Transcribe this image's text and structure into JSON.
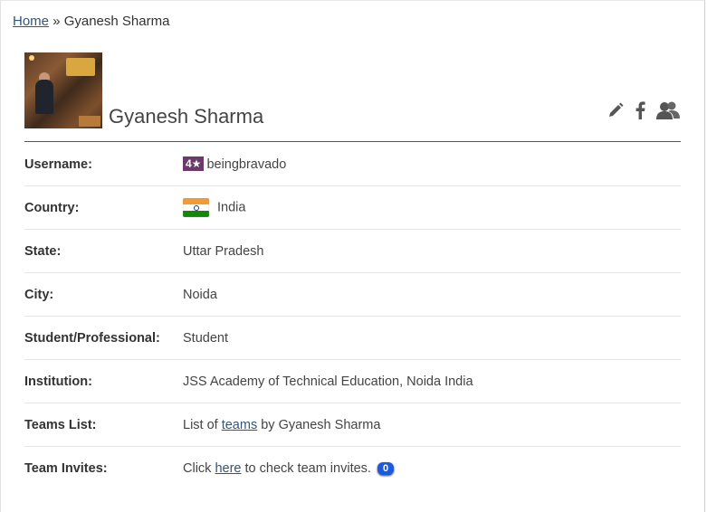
{
  "breadcrumb": {
    "home": "Home",
    "separator": " » ",
    "current": "Gyanesh Sharma"
  },
  "profile": {
    "name": "Gyanesh Sharma",
    "actions": [
      "pencil-icon",
      "facebook-icon",
      "users-icon"
    ]
  },
  "rows": {
    "username": {
      "label": "Username:",
      "stars": "4★",
      "value": "beingbravado"
    },
    "country": {
      "label": "Country:",
      "value": "India"
    },
    "state": {
      "label": "State:",
      "value": "Uttar Pradesh"
    },
    "city": {
      "label": "City:",
      "value": "Noida"
    },
    "student": {
      "label": "Student/Professional:",
      "value": "Student"
    },
    "institution": {
      "label": "Institution:",
      "value": "JSS Academy of Technical Education, Noida India"
    },
    "teams": {
      "label": "Teams List:",
      "prefix": "List of ",
      "link": "teams",
      "suffix": " by Gyanesh Sharma"
    },
    "invites": {
      "label": "Team Invites:",
      "prefix": "Click ",
      "link": "here",
      "suffix": " to check team invites.",
      "count": "0"
    }
  },
  "colors": {
    "link": "#33557a",
    "star_badge": "#6b3a6b",
    "invite_badge": "#1a5adf"
  }
}
